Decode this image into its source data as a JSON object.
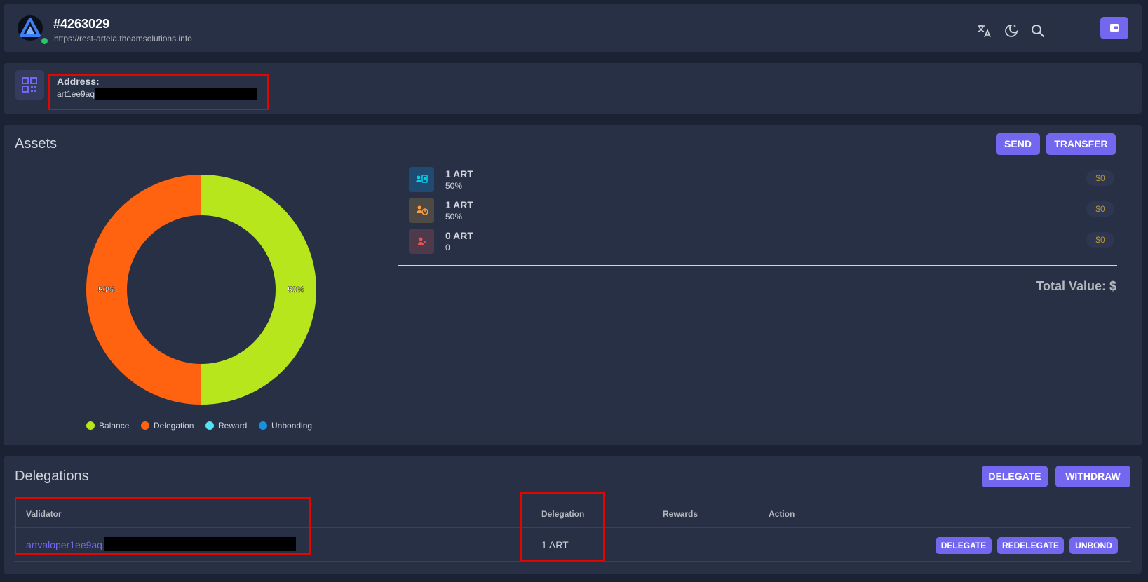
{
  "header": {
    "title": "#4263029",
    "url": "https://rest-artela.theamsolutions.info",
    "icons": [
      "translate-icon",
      "dark-mode-icon",
      "search-icon",
      "wallet-icon"
    ]
  },
  "address": {
    "label": "Address:",
    "value": "art1ee9aq"
  },
  "assets": {
    "title": "Assets",
    "send_label": "SEND",
    "transfer_label": "TRANSFER",
    "items": [
      {
        "amount": "1 ART",
        "percent": "50%",
        "value": "$0",
        "icon": "balance-icon",
        "color": "#00cfe8"
      },
      {
        "amount": "1 ART",
        "percent": "50%",
        "value": "$0",
        "icon": "delegation-clock-icon",
        "color": "#ff9f43"
      },
      {
        "amount": "0 ART",
        "percent": "0",
        "value": "$0",
        "icon": "unbonding-user-icon",
        "color": "#ea5455"
      }
    ],
    "total_label": "Total Value: $"
  },
  "chart_data": {
    "type": "pie",
    "donut": true,
    "categories": [
      "Balance",
      "Delegation",
      "Reward",
      "Unbonding"
    ],
    "values": [
      50,
      50,
      0,
      0
    ],
    "slice_labels": [
      "50%",
      "50%"
    ],
    "colors": [
      "#b8e61c",
      "#ff6310",
      "#4de5f5",
      "#1b8ee0"
    ],
    "legend_placement": "bottom"
  },
  "delegations": {
    "title": "Delegations",
    "delegate_label": "DELEGATE",
    "withdraw_label": "WITHDRAW",
    "columns": [
      "Validator",
      "Delegation",
      "Rewards",
      "Action"
    ],
    "rows": [
      {
        "validator": "artvaloper1ee9aq",
        "delegation": "1 ART",
        "rewards": "",
        "actions": [
          "DELEGATE",
          "REDELEGATE",
          "UNBOND"
        ]
      }
    ]
  },
  "colors": {
    "background": "#1b2234",
    "card": "#283046",
    "primary": "#7367f0",
    "highlight_box": "#e10600"
  }
}
